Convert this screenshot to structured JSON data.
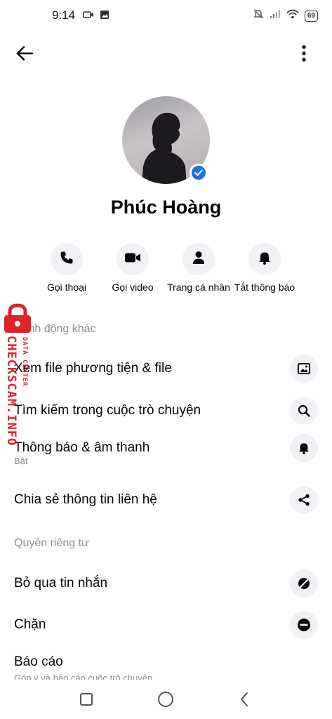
{
  "status_bar": {
    "time": "9:14",
    "battery": "69",
    "left_icons": [
      "video-camera-icon",
      "image-icon"
    ],
    "right_icons": [
      "bell-off-icon",
      "signal-icon",
      "wifi-icon",
      "battery-icon"
    ]
  },
  "top_bar": {
    "back_icon": "arrow-left-icon",
    "more_icon": "more-vertical-icon"
  },
  "profile": {
    "name": "Phúc Hoàng",
    "verified": true,
    "accent_color": "#1b74e4"
  },
  "actions": [
    {
      "label": "Gọi thoại",
      "icon": "phone-icon"
    },
    {
      "label": "Gọi video",
      "icon": "video-icon"
    },
    {
      "label": "Trang cá nhân",
      "icon": "person-icon"
    },
    {
      "label": "Tắt thông báo",
      "icon": "bell-icon"
    }
  ],
  "sections": {
    "other_actions": "Hành động khác",
    "privacy": "Quyền riêng tư"
  },
  "rows": {
    "media": {
      "title": "Xem file phương tiện & file",
      "icon": "image-icon"
    },
    "search": {
      "title": "Tìm kiếm trong cuộc trò chuyện",
      "icon": "search-icon"
    },
    "notifications": {
      "title": "Thông báo & âm thanh",
      "subtitle": "Bật",
      "icon": "bell-icon"
    },
    "share": {
      "title": "Chia sẻ thông tin liên hệ",
      "icon": "share-icon"
    },
    "ignore": {
      "title": "Bỏ qua tin nhắn",
      "icon": "ignore-icon"
    },
    "block": {
      "title": "Chặn",
      "icon": "block-icon"
    },
    "report": {
      "title": "Báo cáo",
      "subtitle": "Góp ý và báo cáo cuộc trò chuyện"
    }
  },
  "nav_bar": {
    "icons": [
      "recents-square-icon",
      "home-circle-icon",
      "back-triangle-icon"
    ]
  },
  "watermark": {
    "main": "CHECKSCAM.INFO",
    "sub": "DATA CENTER",
    "color": "#e0222b"
  }
}
